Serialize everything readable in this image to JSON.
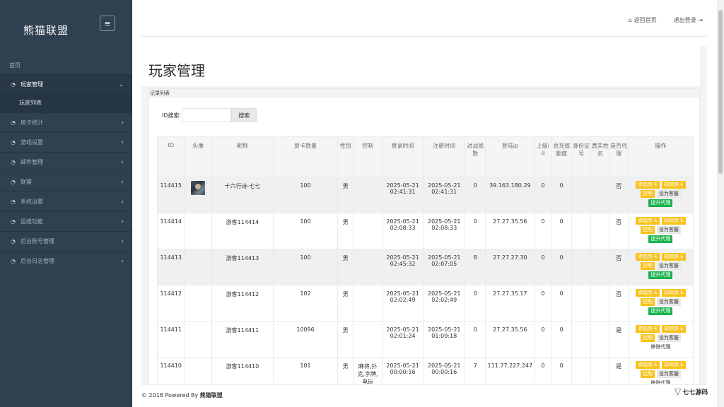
{
  "sidebar": {
    "logo": "熊猫联盟",
    "menu_icon": "≡",
    "home": "首页",
    "items": [
      {
        "label": "玩家管理",
        "icon": "dashboard-icon",
        "active": true
      },
      {
        "label": "房卡统计",
        "icon": "dashboard-icon"
      },
      {
        "label": "游戏设置",
        "icon": "dashboard-icon"
      },
      {
        "label": "邮件管理",
        "icon": "dashboard-icon"
      },
      {
        "label": "联盟",
        "icon": "dashboard-icon"
      },
      {
        "label": "系统设置",
        "icon": "dashboard-icon"
      },
      {
        "label": "运维功能",
        "icon": "dashboard-icon"
      },
      {
        "label": "后台账号管理",
        "icon": "dashboard-icon"
      },
      {
        "label": "后台日志管理",
        "icon": "dashboard-icon"
      }
    ],
    "sub_item": "玩家列表"
  },
  "topbar": {
    "home_link": "返回首页",
    "logout_link": "退出登录"
  },
  "page": {
    "title": "玩家管理",
    "panel_title": "记录列表",
    "search_label": "ID搜索:",
    "search_value": "",
    "search_button": "搜索"
  },
  "table": {
    "headers": [
      "ID",
      "头像",
      "昵称",
      "房卡数量",
      "性别",
      "控制",
      "登录时间",
      "注册时间",
      "对战局数",
      "登陆ip",
      "上级id",
      "总充值额度",
      "身份证号",
      "真实姓名",
      "是否代理",
      "操作"
    ],
    "rows": [
      {
        "id": "114415",
        "avatar": true,
        "nick": "十六行诗-七七",
        "cards": "100",
        "gender": "男",
        "control": "",
        "login": "2025-05-21 02:41:31",
        "reg": "2025-05-21 02:41:31",
        "games": "0",
        "ip": "39.163.180.29",
        "parent": "0",
        "recharge": "0",
        "idcard": "",
        "realname": "",
        "agent": "否",
        "agent_action": "提升代理"
      },
      {
        "id": "114414",
        "avatar": false,
        "nick": "游客114414",
        "cards": "100",
        "gender": "男",
        "control": "",
        "login": "2025-05-21 02:08:33",
        "reg": "2025-05-21 02:08:33",
        "games": "0",
        "ip": "27.27.35.56",
        "parent": "0",
        "recharge": "0",
        "idcard": "",
        "realname": "",
        "agent": "否",
        "agent_action": "提升代理"
      },
      {
        "id": "114413",
        "avatar": false,
        "nick": "游客114413",
        "cards": "100",
        "gender": "男",
        "control": "",
        "login": "2025-05-21 02:45:32",
        "reg": "2025-05-21 02:07:05",
        "games": "8",
        "ip": "27.27.27.30",
        "parent": "0",
        "recharge": "0",
        "idcard": "",
        "realname": "",
        "agent": "否",
        "agent_action": "提升代理"
      },
      {
        "id": "114412",
        "avatar": false,
        "nick": "游客114412",
        "cards": "102",
        "gender": "男",
        "control": "",
        "login": "2025-05-21 02:02:49",
        "reg": "2025-05-21 02:02:49",
        "games": "0",
        "ip": "27.27.35.17",
        "parent": "0",
        "recharge": "0",
        "idcard": "",
        "realname": "",
        "agent": "否",
        "agent_action": "提升代理"
      },
      {
        "id": "114411",
        "avatar": false,
        "nick": "游客114411",
        "cards": "10096",
        "gender": "男",
        "control": "",
        "login": "2025-05-21 02:01:24",
        "reg": "2025-05-21 01:09:18",
        "games": "0",
        "ip": "27.27.35.56",
        "parent": "0",
        "recharge": "0",
        "idcard": "",
        "realname": "",
        "agent": "是",
        "agent_action": "移除代理"
      },
      {
        "id": "114410",
        "avatar": false,
        "nick": "游客114410",
        "cards": "101",
        "gender": "男",
        "control": "麻将,扑克,字牌,电玩",
        "login": "2025-05-21 00:00:16",
        "reg": "2025-05-21 00:00:16",
        "games": "7",
        "ip": "111.77.227.247",
        "parent": "0",
        "recharge": "0",
        "idcard": "",
        "realname": "",
        "agent": "是",
        "agent_action": "移除代理"
      }
    ],
    "actions": {
      "add_cards": "添加房卡",
      "remove_cards": "扣除房卡",
      "control": "控制",
      "set_service": "设为客服"
    }
  },
  "footer": {
    "prefix": "© 2018 Powered By ",
    "brand": "熊猫联盟"
  },
  "watermark": {
    "text": "七七源码"
  },
  "colors": {
    "sidebar_bg": "#2f4050",
    "yellow_btn": "#f8c21c",
    "green_btn": "#1ab34e"
  }
}
